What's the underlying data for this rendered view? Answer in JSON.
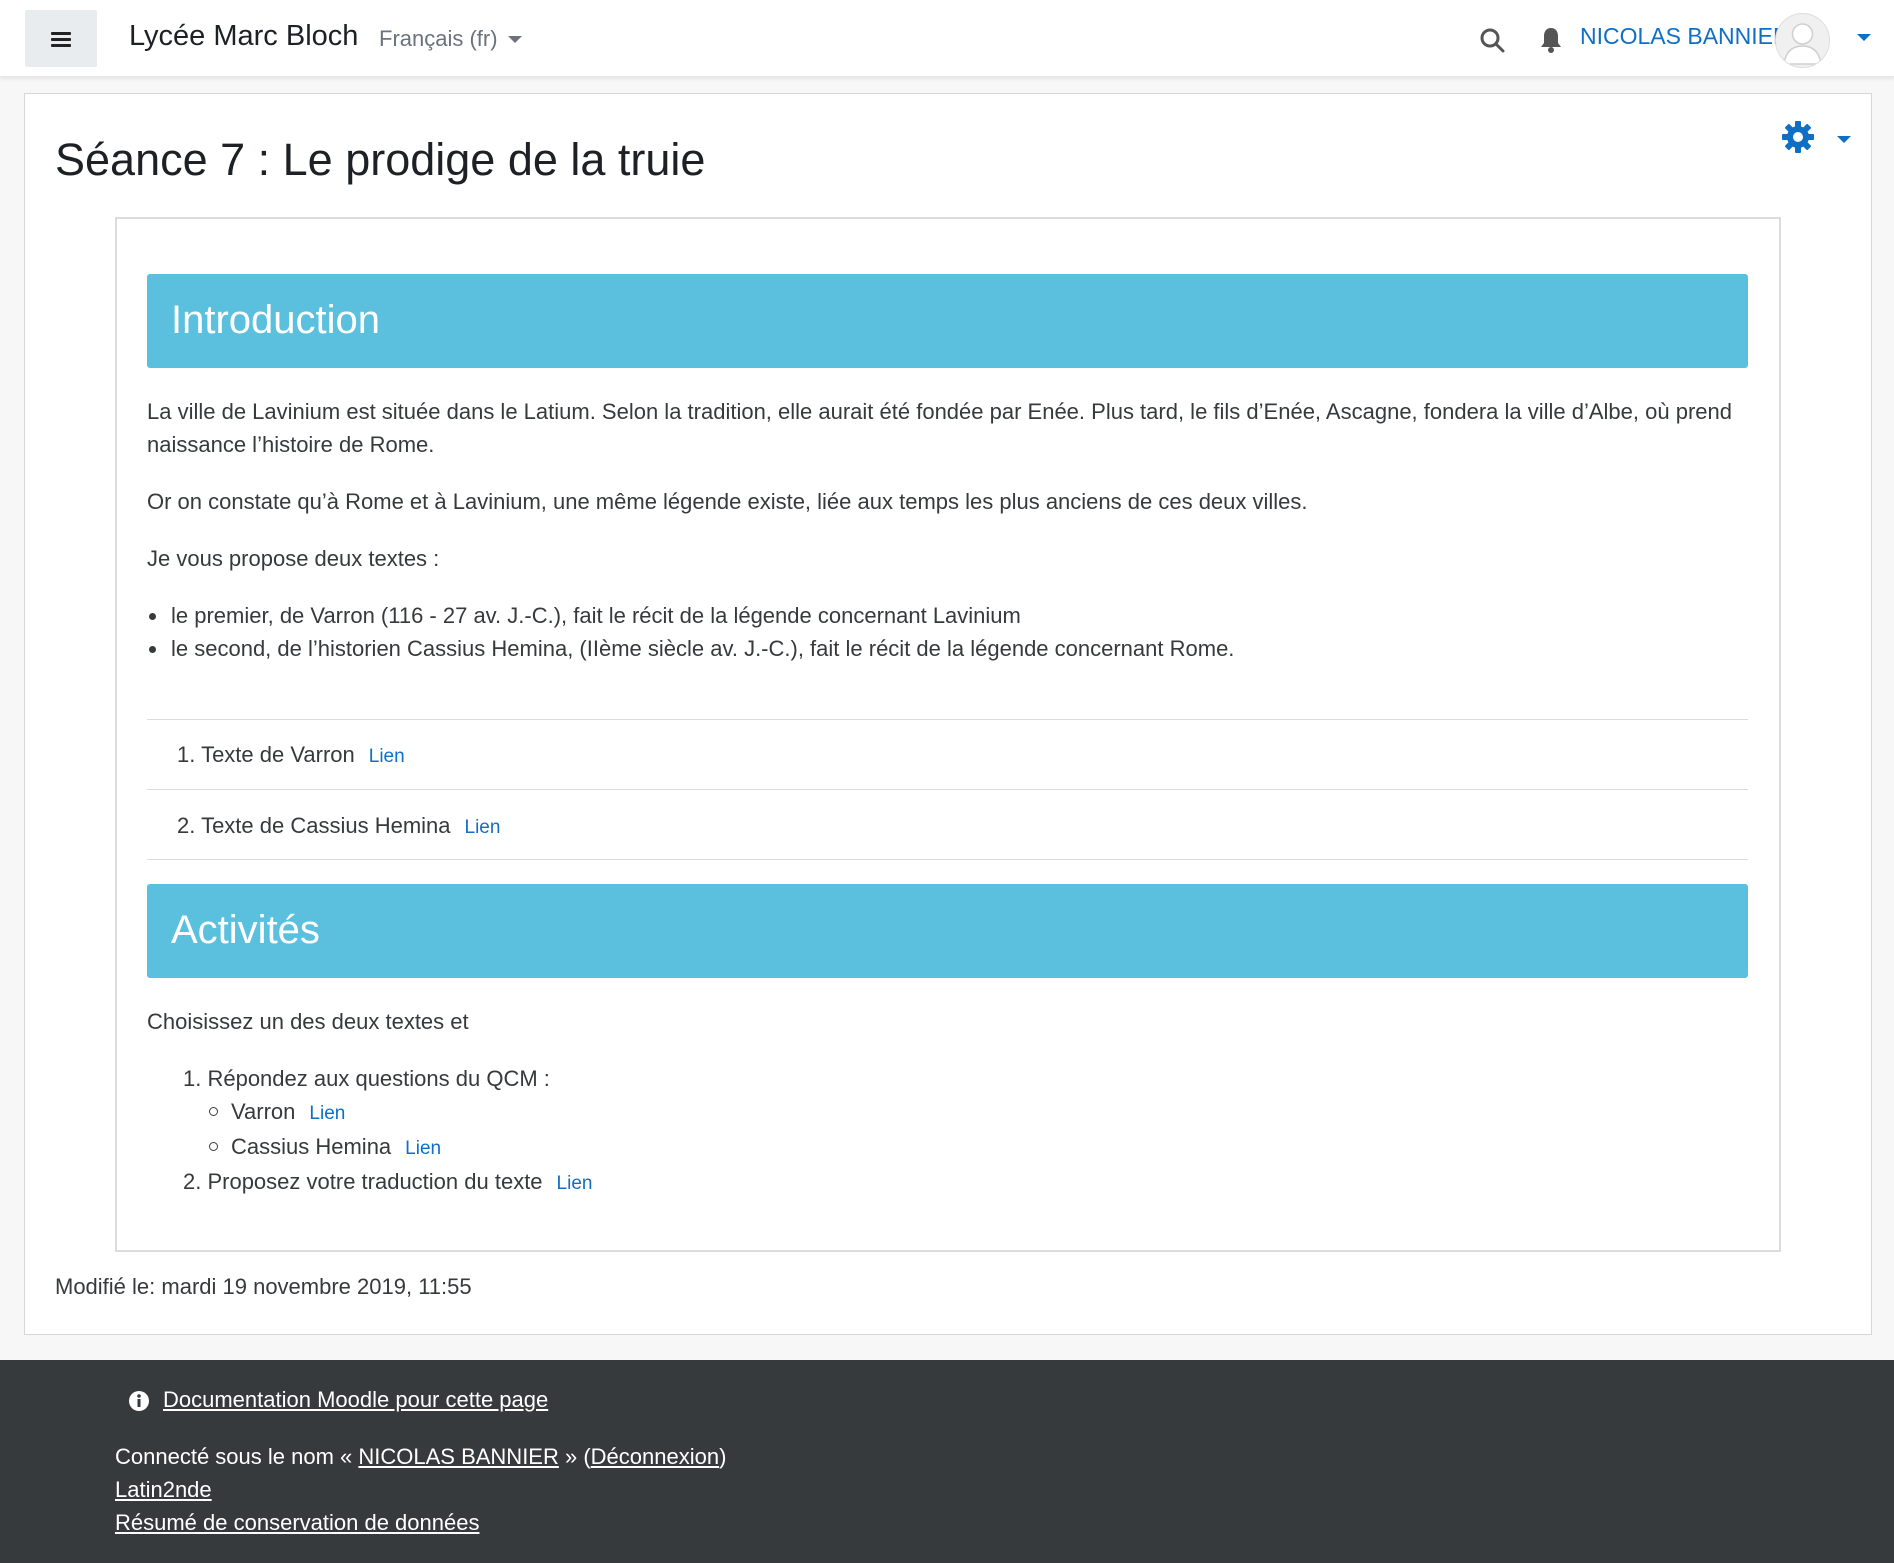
{
  "navbar": {
    "brand": "Lycée Marc Bloch",
    "language": "Français (fr)",
    "user_name": "NICOLAS BANNIER"
  },
  "page": {
    "title": "Séance 7 : Le prodige de la truie",
    "introduction": {
      "heading": "Introduction",
      "paragraph1": "La ville de Lavinium est située dans le Latium. Selon la tradition, elle aurait été fondée par Enée. Plus tard, le fils d’Enée, Ascagne, fondera la ville d’Albe, où prend naissance l’histoire de Rome.",
      "paragraph2": "Or on constate qu’à Rome et à Lavinium, une même légende existe, liée aux temps les plus anciens de ces deux villes.",
      "paragraph3": "Je vous propose deux textes :",
      "bullets": [
        "le premier, de Varron (116 - 27 av. J.-C.), fait le récit de la légende concernant Lavinium",
        "le second, de l’historien Cassius Hemina, (IIème siècle av. J.-C.), fait le récit de la légende concernant Rome."
      ],
      "links": [
        {
          "label": "1. Texte de Varron",
          "link": "Lien"
        },
        {
          "label": "2. Texte de Cassius Hemina",
          "link": "Lien"
        }
      ]
    },
    "activities": {
      "heading": "Activités",
      "intro": "Choisissez un des deux textes et",
      "item1": "1. Répondez aux questions du QCM :",
      "sub1": "Varron",
      "sub2": "Cassius Hemina",
      "item2": "2. Proposez votre traduction du texte",
      "link": "Lien"
    },
    "modified": "Modifié le: mardi 19 novembre 2019, 11:55"
  },
  "footer": {
    "doc_link": "Documentation Moodle pour cette page",
    "logged_prefix": "Connecté sous le nom « ",
    "logged_user": "NICOLAS BANNIER",
    "logged_middle": " » (",
    "logout": "Déconnexion",
    "logged_suffix": ")",
    "course": "Latin2nde",
    "privacy": "Résumé de conservation de données"
  },
  "colors": {
    "accent": "#0f6fc5",
    "banner": "#5bc0de",
    "footer_bg": "#373a3c"
  }
}
